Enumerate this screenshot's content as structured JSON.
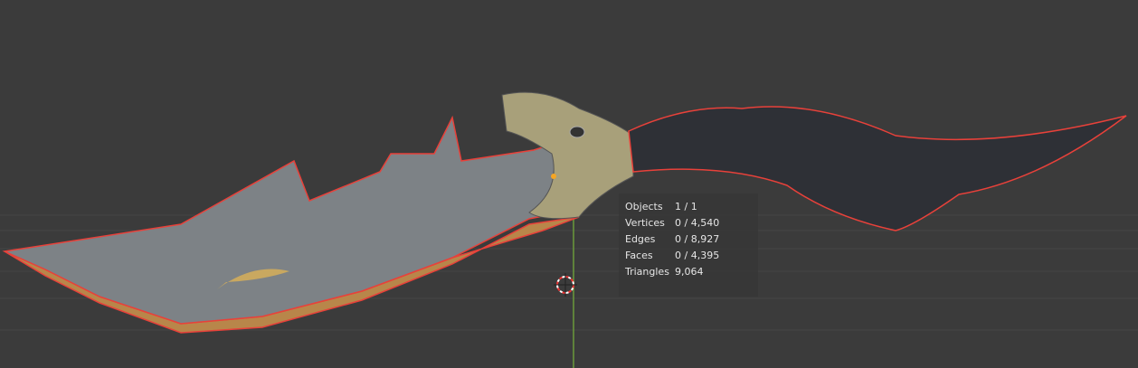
{
  "stats": [
    {
      "label": "Objects",
      "value": "1 / 1"
    },
    {
      "label": "Vertices",
      "value": "0 / 4,540"
    },
    {
      "label": "Edges",
      "value": "0 / 8,927"
    },
    {
      "label": "Faces",
      "value": "0 / 4,395"
    },
    {
      "label": "Triangles",
      "value": "9,064"
    }
  ],
  "colors": {
    "background": "#3b3b3b",
    "selection_outline": "#e8413a",
    "y_axis": "#6a9a3a"
  }
}
